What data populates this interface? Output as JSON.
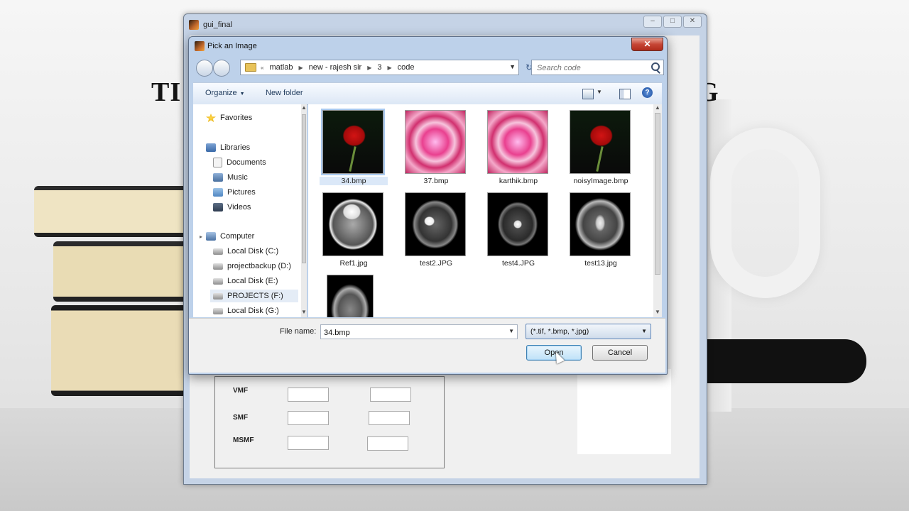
{
  "background": {
    "title_left": "TI",
    "title_right": "G"
  },
  "gui_window": {
    "title": "gui_final",
    "controls": {
      "minimize": "–",
      "maximize": "□",
      "close": "✕"
    },
    "rows": [
      {
        "label": "VMF"
      },
      {
        "label": "SMF"
      },
      {
        "label": "MSMF"
      }
    ]
  },
  "dialog": {
    "title": "Pick an Image",
    "close_label": "✕",
    "breadcrumb": [
      "matlab",
      "new - rajesh sir",
      "3",
      "code"
    ],
    "breadcrumb_prefix": "«",
    "search_placeholder": "Search code",
    "toolbar": {
      "organize_label": "Organize",
      "new_folder_label": "New folder",
      "help_label": "?"
    },
    "nav_pane": {
      "favorites": "Favorites",
      "libraries": "Libraries",
      "documents": "Documents",
      "music": "Music",
      "pictures": "Pictures",
      "videos": "Videos",
      "computer": "Computer",
      "drives": [
        "Local Disk (C:)",
        "projectbackup (D:)",
        "Local Disk (E:)",
        "PROJECTS (F:)",
        "Local Disk (G:)"
      ]
    },
    "files": [
      {
        "name": "34.bmp",
        "selected": true
      },
      {
        "name": "37.bmp"
      },
      {
        "name": "karthik.bmp"
      },
      {
        "name": "noisyImage.bmp"
      },
      {
        "name": "Ref1.jpg"
      },
      {
        "name": "test2.JPG"
      },
      {
        "name": "test4.JPG"
      },
      {
        "name": "test13.jpg"
      },
      {
        "name": ""
      }
    ],
    "file_name_label": "File name:",
    "file_name_value": "34.bmp",
    "filter_value": "(*.tif, *.bmp, *.jpg)",
    "open_label": "Open",
    "cancel_label": "Cancel"
  }
}
